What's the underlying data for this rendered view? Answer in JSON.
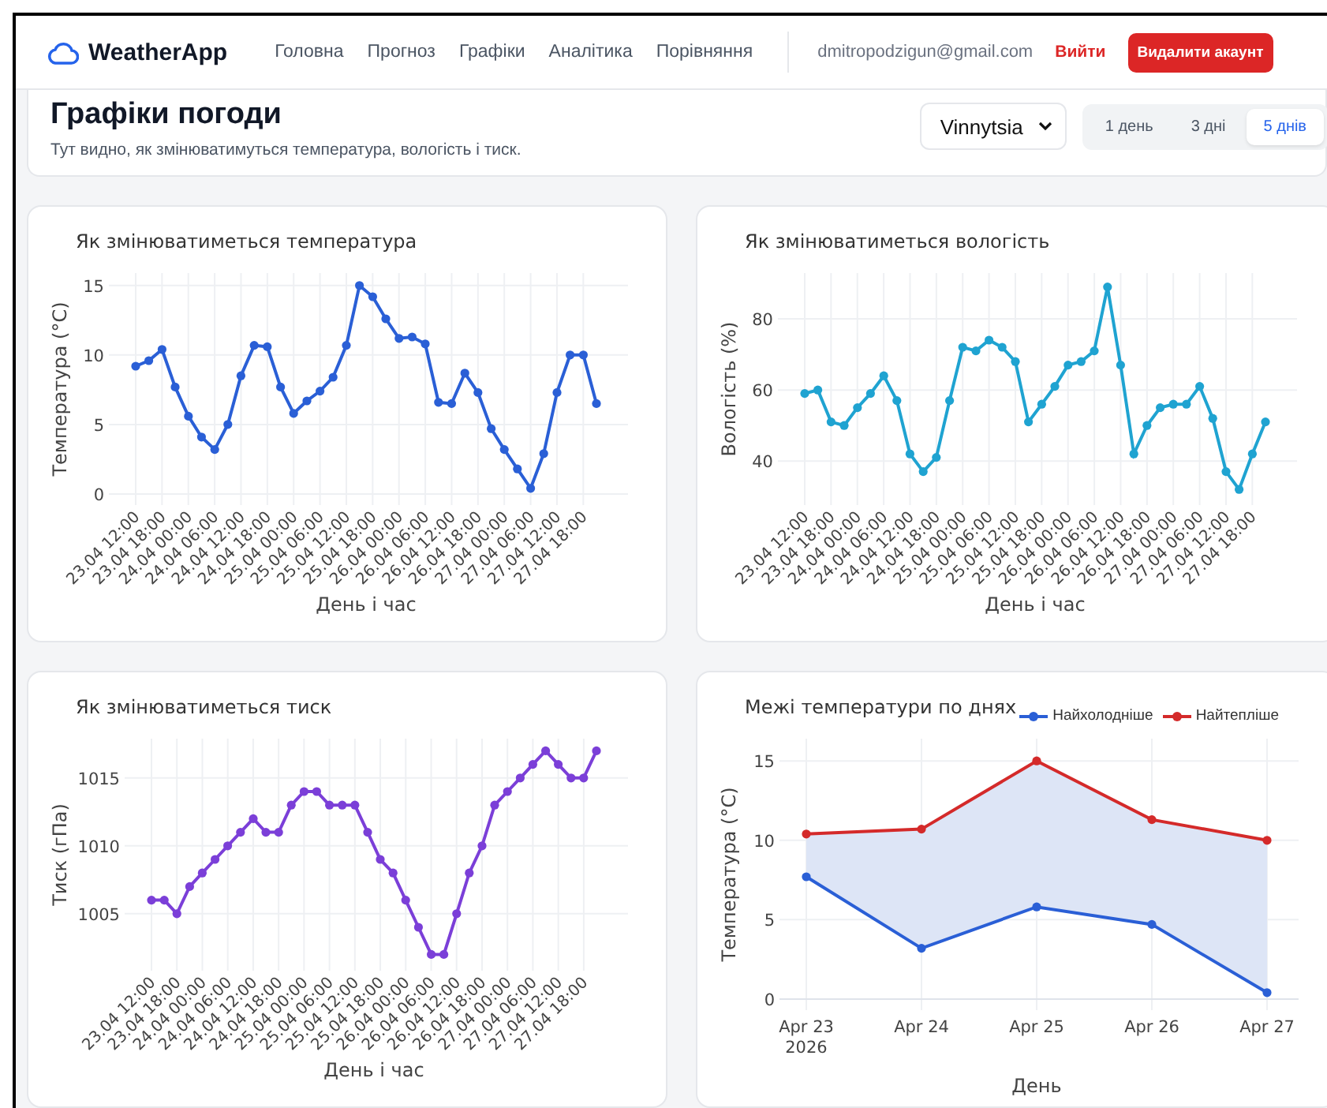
{
  "header": {
    "logo": "WeatherApp",
    "nav": [
      {
        "label": "Головна"
      },
      {
        "label": "Прогноз"
      },
      {
        "label": "Графіки"
      },
      {
        "label": "Аналітика"
      },
      {
        "label": "Порівняння"
      }
    ],
    "email": "dmitropodzigun@gmail.com",
    "logout": "Вийти",
    "delete_button": "Видалити акаунт"
  },
  "page": {
    "title": "Графіки погоди",
    "subtitle": "Тут видно, як змінюватимуться температура, вологість і тиск.",
    "city_select": {
      "value": "Vinnytsia"
    },
    "ranges": [
      {
        "label": "1 день",
        "selected": false
      },
      {
        "label": "3 дні",
        "selected": false
      },
      {
        "label": "5 днів",
        "selected": true
      }
    ]
  },
  "charts": [
    {
      "chart_data": {
        "type": "line",
        "title": "Як змінюватиметься температура",
        "xlabel": "День і час",
        "ylabel": "Температура (°C)",
        "categories": [
          "23.04 12:00",
          null,
          "23.04 18:00",
          null,
          "24.04 00:00",
          null,
          "24.04 06:00",
          null,
          "24.04 12:00",
          null,
          "24.04 18:00",
          null,
          "25.04 00:00",
          null,
          "25.04 06:00",
          null,
          "25.04 12:00",
          null,
          "25.04 18:00",
          null,
          "26.04 00:00",
          null,
          "26.04 06:00",
          null,
          "26.04 12:00",
          null,
          "26.04 18:00",
          null,
          "27.04 00:00",
          null,
          "27.04 06:00",
          null,
          "27.04 12:00",
          null,
          "27.04 18:00",
          null
        ],
        "series": [
          {
            "color": "#2a5fd6",
            "marker": true,
            "values": [
              9.2,
              9.6,
              10.4,
              7.7,
              5.6,
              4.1,
              3.2,
              5.0,
              8.5,
              10.7,
              10.6,
              7.7,
              5.8,
              6.7,
              7.4,
              8.4,
              10.7,
              15.0,
              14.2,
              12.6,
              11.2,
              11.3,
              10.8,
              6.6,
              6.5,
              8.7,
              7.3,
              4.7,
              3.2,
              1.8,
              0.4,
              2.9,
              7.3,
              10.0,
              10.0,
              6.5
            ]
          }
        ],
        "ylim": [
          -0.8,
          15.9
        ],
        "yticks": [
          0,
          5,
          10,
          15
        ],
        "grid": true
      }
    },
    {
      "chart_data": {
        "type": "line",
        "title": "Як змінюватиметься вологість",
        "xlabel": "День і час",
        "ylabel": "Вологість (%)",
        "categories": [
          "23.04 12:00",
          null,
          "23.04 18:00",
          null,
          "24.04 00:00",
          null,
          "24.04 06:00",
          null,
          "24.04 12:00",
          null,
          "24.04 18:00",
          null,
          "25.04 00:00",
          null,
          "25.04 06:00",
          null,
          "25.04 12:00",
          null,
          "25.04 18:00",
          null,
          "26.04 00:00",
          null,
          "26.04 06:00",
          null,
          "26.04 12:00",
          null,
          "26.04 18:00",
          null,
          "27.04 00:00",
          null,
          "27.04 06:00",
          null,
          "27.04 12:00",
          null,
          "27.04 18:00",
          null
        ],
        "series": [
          {
            "color": "#1fa3d1",
            "marker": true,
            "values": [
              59,
              60,
              51,
              50,
              55,
              59,
              64,
              57,
              42,
              37,
              41,
              57,
              72,
              71,
              74,
              72,
              68,
              51,
              56,
              61,
              67,
              68,
              71,
              89,
              67,
              42,
              50,
              55,
              56,
              56,
              61,
              52,
              37,
              32,
              42,
              51
            ]
          }
        ],
        "ylim": [
          27.6,
          92.9
        ],
        "yticks": [
          40,
          60,
          80
        ],
        "grid": true
      }
    },
    {
      "chart_data": {
        "type": "line",
        "title": "Як змінюватиметься тиск",
        "xlabel": "День і час",
        "ylabel": "Тиск (гПа)",
        "categories": [
          "23.04 12:00",
          null,
          "23.04 18:00",
          null,
          "24.04 00:00",
          null,
          "24.04 06:00",
          null,
          "24.04 12:00",
          null,
          "24.04 18:00",
          null,
          "25.04 00:00",
          null,
          "25.04 06:00",
          null,
          "25.04 12:00",
          null,
          "25.04 18:00",
          null,
          "26.04 00:00",
          null,
          "26.04 06:00",
          null,
          "26.04 12:00",
          null,
          "26.04 18:00",
          null,
          "27.04 00:00",
          null,
          "27.04 06:00",
          null,
          "27.04 12:00",
          null,
          "27.04 18:00",
          null
        ],
        "series": [
          {
            "color": "#7b3fd8",
            "marker": true,
            "values": [
              1006,
              1006,
              1005,
              1007,
              1008,
              1009,
              1010,
              1011,
              1012,
              1011,
              1011,
              1013,
              1014,
              1014,
              1013,
              1013,
              1013,
              1011,
              1009,
              1008,
              1006,
              1004,
              1002,
              1002,
              1005,
              1008,
              1010,
              1013,
              1014,
              1015,
              1016,
              1017,
              1016,
              1015,
              1015,
              1017
            ]
          }
        ],
        "ylim": [
          1000.8,
          1017.9
        ],
        "yticks": [
          1005,
          1010,
          1015
        ],
        "grid": true
      }
    },
    {
      "chart_data": {
        "type": "line",
        "title": "Межі температури по днях",
        "xlabel": "День",
        "ylabel": "Температура (°C)",
        "categories": [
          "Apr 23\n2026",
          "Apr 24",
          "Apr 25",
          "Apr 26",
          "Apr 27"
        ],
        "series": [
          {
            "name": "Найхолодніше",
            "color": "#2a5fd6",
            "marker": true,
            "values": [
              7.7,
              3.2,
              5.8,
              4.7,
              0.4
            ]
          },
          {
            "name": "Найтепліше",
            "color": "#d42a2a",
            "marker": true,
            "type": "area",
            "values": [
              10.4,
              10.7,
              15.0,
              11.3,
              10.0
            ]
          }
        ],
        "ylim": [
          -0.7,
          16.4
        ],
        "yticks": [
          0,
          5,
          10,
          15
        ],
        "grid": true
      }
    }
  ]
}
